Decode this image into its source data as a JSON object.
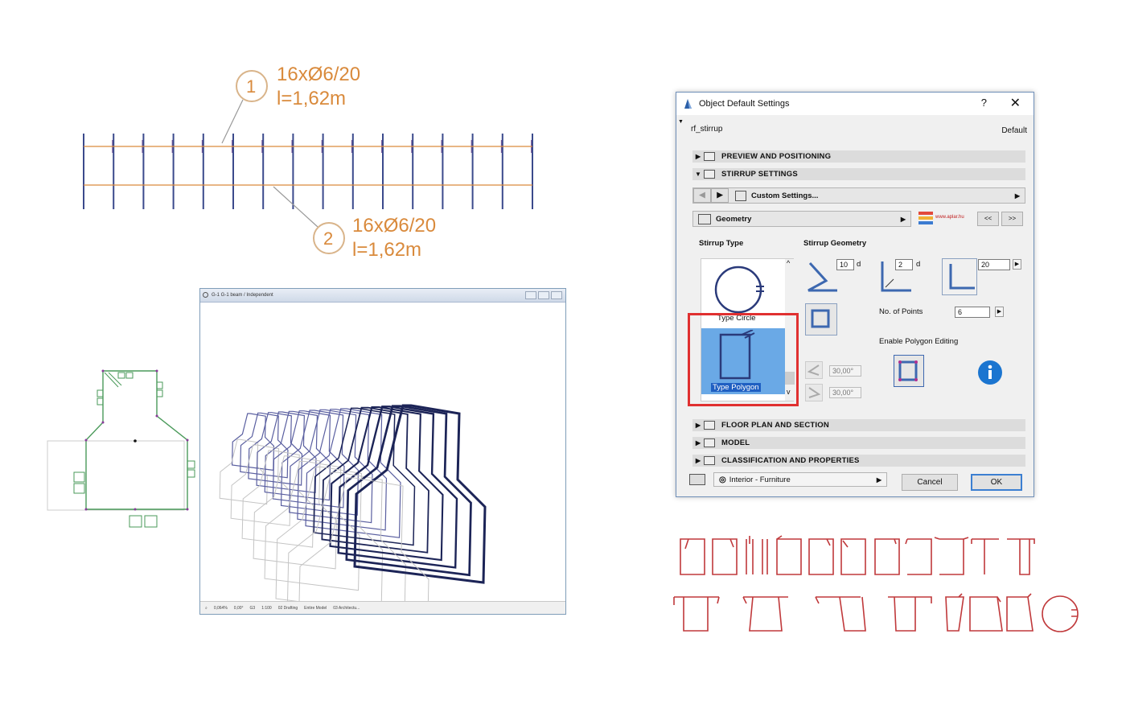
{
  "rebar_plan": {
    "callout_1": {
      "number": "1",
      "line1": "16xØ6/20",
      "line2": "l=1,62m"
    },
    "callout_2": {
      "number": "2",
      "line1": "16xØ6/20",
      "line2": "l=1,62m"
    },
    "colors": {
      "callout": "#d98a3c",
      "bars": "#3b4a8c"
    }
  },
  "view3d": {
    "title": "G-1 G-1 beam / Independent",
    "status_items": [
      "0,064%",
      "0,00°",
      "G3",
      "1:100",
      "02 Drafting",
      "Entire Model",
      "03 Architectu..."
    ]
  },
  "dialog": {
    "title": "Object Default Settings",
    "help_label": "?",
    "close_label": "✕",
    "object_name": "rf_stirrup",
    "default_label": "Default",
    "sections": {
      "preview": "PREVIEW AND POSITIONING",
      "stirrup": "STIRRUP SETTINGS",
      "floor_plan": "FLOOR PLAN AND SECTION",
      "model": "MODEL",
      "classification": "CLASSIFICATION AND PROPERTIES"
    },
    "custom_settings_label": "Custom Settings...",
    "page_select_label": "Geometry",
    "logo_text": "www.aplar.hu",
    "nav_prev": "<<",
    "nav_next": ">>",
    "stirrup_type_label": "Stirrup Type",
    "stirrup_geometry_label": "Stirrup Geometry",
    "type_circle_label": "Type Circle",
    "type_polygon_label": "Type Polygon",
    "hook_length_value": "10",
    "hook_unit_1": "d",
    "bend_value": "2",
    "hook_unit_2": "d",
    "cover_value": "20",
    "num_points_label": "No. of Points",
    "num_points_value": "6",
    "enable_polygon_label": "Enable Polygon Editing",
    "angle_1": "30,00°",
    "angle_2": "30,00°",
    "layer_value": "Interior - Furniture",
    "cancel_label": "Cancel",
    "ok_label": "OK",
    "colors": {
      "selection": "#6aa9e6",
      "highlight": "#e03030",
      "info": "#1b75d0"
    }
  },
  "stirrup_library": {
    "color": "#c0393b"
  }
}
